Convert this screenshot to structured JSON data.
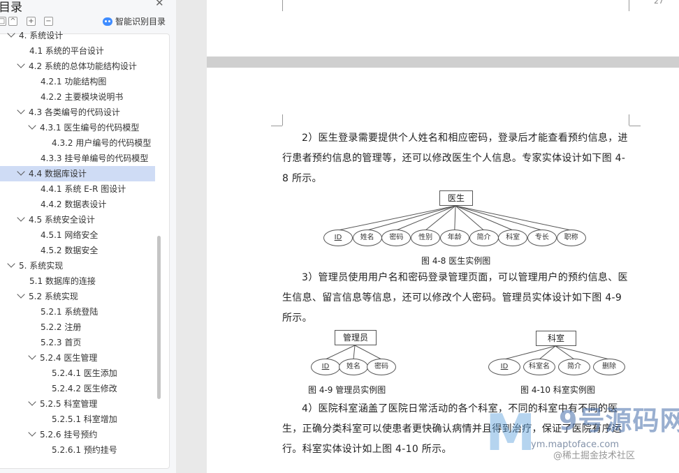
{
  "sidebar": {
    "title": "目录",
    "smart_toc_label": "智能识别目录",
    "items": [
      {
        "label": "4. 系统设计",
        "level": 0,
        "chevron": true
      },
      {
        "label": "4.1  系统的平台设计",
        "level": 1,
        "chevron": false
      },
      {
        "label": "4.2  系统的总体功能结构设计",
        "level": 1,
        "chevron": true
      },
      {
        "label": "4.2.1  功能结构图",
        "level": 2,
        "chevron": false
      },
      {
        "label": "4.2.2  主要模块说明书",
        "level": 2,
        "chevron": false
      },
      {
        "label": "4.3  各类编号的代码设计",
        "level": 1,
        "chevron": true
      },
      {
        "label": "4.3.1  医生编号的代码模型",
        "level": 2,
        "chevron": true
      },
      {
        "label": "4.3.2  用户编号的代码模型",
        "level": 3,
        "chevron": false
      },
      {
        "label": "4.3.3  挂号单编号的代码模型",
        "level": 2,
        "chevron": false
      },
      {
        "label": "4.4  数据库设计",
        "level": 1,
        "chevron": true,
        "active": true
      },
      {
        "label": "4.4.1  系统 E-R 图设计",
        "level": 2,
        "chevron": false
      },
      {
        "label": "4.4.2  数据表设计",
        "level": 2,
        "chevron": false
      },
      {
        "label": "4.5  系统安全设计",
        "level": 1,
        "chevron": true
      },
      {
        "label": "4.5.1  网络安全",
        "level": 2,
        "chevron": false
      },
      {
        "label": "4.5.2  数据安全",
        "level": 2,
        "chevron": false
      },
      {
        "label": "5.  系统实现",
        "level": 0,
        "chevron": true
      },
      {
        "label": "5.1  数据库的连接",
        "level": 1,
        "chevron": false
      },
      {
        "label": "5.2  系统实现",
        "level": 1,
        "chevron": true
      },
      {
        "label": "5.2.1  系统登陆",
        "level": 2,
        "chevron": false
      },
      {
        "label": "5.2.2  注册",
        "level": 2,
        "chevron": false
      },
      {
        "label": "5.2.3  首页",
        "level": 2,
        "chevron": false
      },
      {
        "label": "5.2.4  医生管理",
        "level": 2,
        "chevron": true
      },
      {
        "label": "5.2.4.1  医生添加",
        "level": 3,
        "chevron": false
      },
      {
        "label": "5.2.4.2  医生修改",
        "level": 3,
        "chevron": false
      },
      {
        "label": "5.2.5  科室管理",
        "level": 2,
        "chevron": true
      },
      {
        "label": "5.2.5.1  科室增加",
        "level": 3,
        "chevron": false
      },
      {
        "label": "5.2.6  挂号预约",
        "level": 2,
        "chevron": true
      },
      {
        "label": "5.2.6.1  预约挂号",
        "level": 3,
        "chevron": false
      }
    ]
  },
  "document": {
    "page_number": "27",
    "para1": "2）医生登录需要提供个人姓名和相应密码，登录后才能查看预约信息，进行患者预约信息的管理等，还可以修改医生个人信息。专家实体设计如下图 4-8 所示。",
    "fig48": {
      "entity": "医生",
      "attributes": [
        "ID",
        "姓名",
        "密码",
        "性别",
        "年龄",
        "简介",
        "科室",
        "专长",
        "职称"
      ],
      "caption": "图 4-8  医生实例图"
    },
    "para2": "3）管理员使用用户名和密码登录管理页面，可以管理用户的预约信息、医生信息、留言信息等信息，还可以修改个人密码。管理员实体设计如下图 4-9 所示。",
    "fig49": {
      "entity": "管理员",
      "attributes": [
        "ID",
        "姓名",
        "密码"
      ],
      "caption": "图 4-9     管理员实例图"
    },
    "fig410": {
      "entity": "科室",
      "attributes": [
        "ID",
        "科室名",
        "简介",
        "删除"
      ],
      "caption": "图 4-10 科室实例图"
    },
    "para3": "4）医院科室涵盖了医院日常活动的各个科室，不同的科室中有不同的医生，正确分类科室可以使患者更快确认病情并且得到治疗，保证了医院有序运行。科室实体设计如上图 4-10 所示。"
  },
  "watermark": {
    "brand": "9号源码网",
    "url": "ym.maptoface.com",
    "sub": "@稀土掘金技术社区"
  },
  "colors": {
    "active_row": "#cfdcf5",
    "accent": "#3f8cff"
  }
}
